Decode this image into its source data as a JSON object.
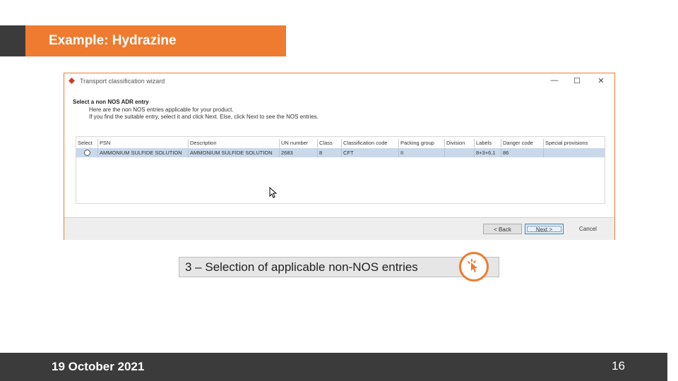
{
  "slide": {
    "title": "Example: Hydrazine",
    "caption": "3 – Selection of applicable non-NOS entries",
    "date": "19 October 2021",
    "page_number": "16"
  },
  "wizard": {
    "title": "Transport classification wizard",
    "heading": "Select a non NOS ADR entry",
    "desc_line1": "Here are the non NOS entries applicable for your product.",
    "desc_line2": "If you find the suitable entry, select it and click Next. Else, click Next to see the NOS entries.",
    "window_controls": {
      "minimize": "—",
      "maximize": "☐",
      "close": "✕"
    },
    "columns": [
      "Select",
      "PSN",
      "Description",
      "UN number",
      "Class",
      "Classification code",
      "Packing group",
      "Division",
      "Labels",
      "Danger code",
      "Special provisions"
    ],
    "rows": [
      [
        "",
        "AMMONIUM SULFIDE SOLUTION",
        "AMMONIUM SULFIDE SOLUTION",
        "2683",
        "8",
        "CFT",
        "II",
        "",
        "8+3+6.1",
        "86",
        ""
      ]
    ],
    "buttons": {
      "back": "< Back",
      "next": "Next >",
      "cancel": "Cancel"
    }
  },
  "colors": {
    "accent": "#ee7b30",
    "dark": "#3b3b3b",
    "row_selected": "#c9d9ea"
  },
  "icons": {
    "title_icon": "app-logo-icon",
    "cursor": "mouse-pointer-icon",
    "caption": "click-hand-icon"
  }
}
